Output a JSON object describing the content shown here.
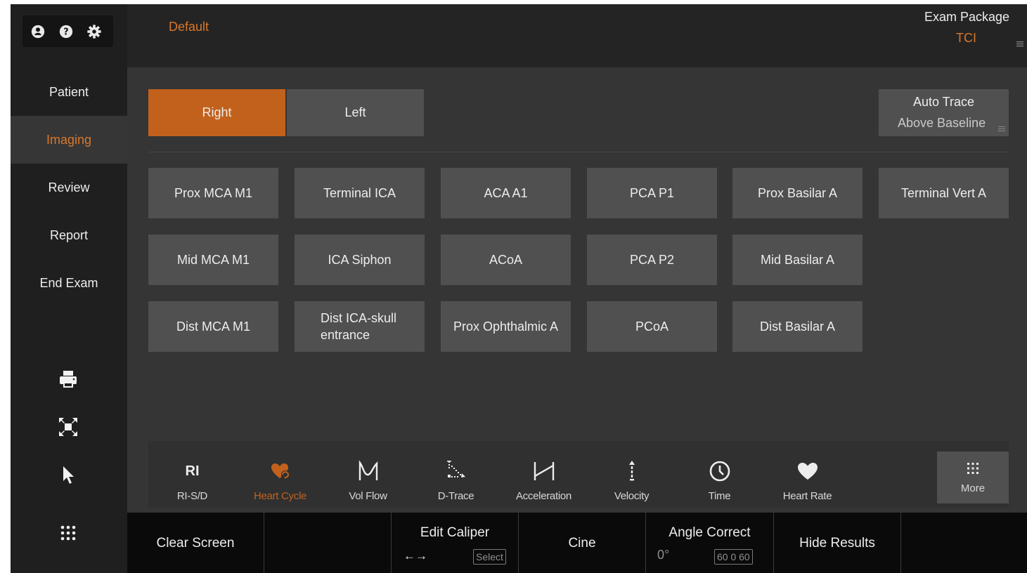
{
  "colors": {
    "accent": "#d9772a",
    "button": "#505050",
    "button_active": "#c2611c",
    "panel": "#353535",
    "sidebar": "#1f1f1f",
    "header": "#242424",
    "softkey_bar": "#0a0a0a"
  },
  "header": {
    "preset": "Default",
    "exam_package_label": "Exam Package",
    "exam_package_value": "TCI"
  },
  "sidebar": {
    "system_icons": [
      "user-icon",
      "help-icon",
      "settings-icon"
    ],
    "items": [
      {
        "label": "Patient",
        "active": false
      },
      {
        "label": "Imaging",
        "active": true
      },
      {
        "label": "Review",
        "active": false
      },
      {
        "label": "Report",
        "active": false
      },
      {
        "label": "End Exam",
        "active": false
      }
    ],
    "tools": [
      "print-icon",
      "fullscreen-icon",
      "pointer-icon",
      "apps-grid-icon"
    ]
  },
  "side_select": {
    "right": "Right",
    "left": "Left",
    "selected": "Right"
  },
  "auto_trace": {
    "title": "Auto Trace",
    "value": "Above Baseline"
  },
  "vessels": [
    [
      "Prox MCA M1",
      "Terminal ICA",
      "ACA A1",
      "PCA P1",
      "Prox Basilar A",
      "Terminal Vert A"
    ],
    [
      "Mid MCA M1",
      "ICA Siphon",
      "ACoA",
      "PCA P2",
      "Mid Basilar A"
    ],
    [
      "Dist MCA M1",
      "Dist ICA-skull entrance",
      "Prox Ophthalmic A",
      "PCoA",
      "Dist Basilar A"
    ]
  ],
  "measure_tools": [
    {
      "label": "RI-S/D",
      "icon": "ri-text-icon",
      "icon_text": "RI",
      "active": false
    },
    {
      "label": "Heart Cycle",
      "icon": "heart-cycle-icon",
      "active": true
    },
    {
      "label": "Vol Flow",
      "icon": "vol-flow-icon",
      "active": false
    },
    {
      "label": "D-Trace",
      "icon": "d-trace-icon",
      "active": false
    },
    {
      "label": "Acceleration",
      "icon": "acceleration-icon",
      "active": false
    },
    {
      "label": "Velocity",
      "icon": "velocity-icon",
      "active": false
    },
    {
      "label": "Time",
      "icon": "clock-icon",
      "active": false
    },
    {
      "label": "Heart Rate",
      "icon": "heart-icon",
      "active": false
    }
  ],
  "more": {
    "label": "More",
    "icon": "grid-dots-icon"
  },
  "softkeys": {
    "clear_screen": "Clear Screen",
    "edit_caliper": {
      "label": "Edit Caliper",
      "arrows": "←→",
      "box": "Select"
    },
    "cine": "Cine",
    "angle_correct": {
      "label": "Angle Correct",
      "value": "0°",
      "box": "60 0 60"
    },
    "hide_results": "Hide Results"
  }
}
